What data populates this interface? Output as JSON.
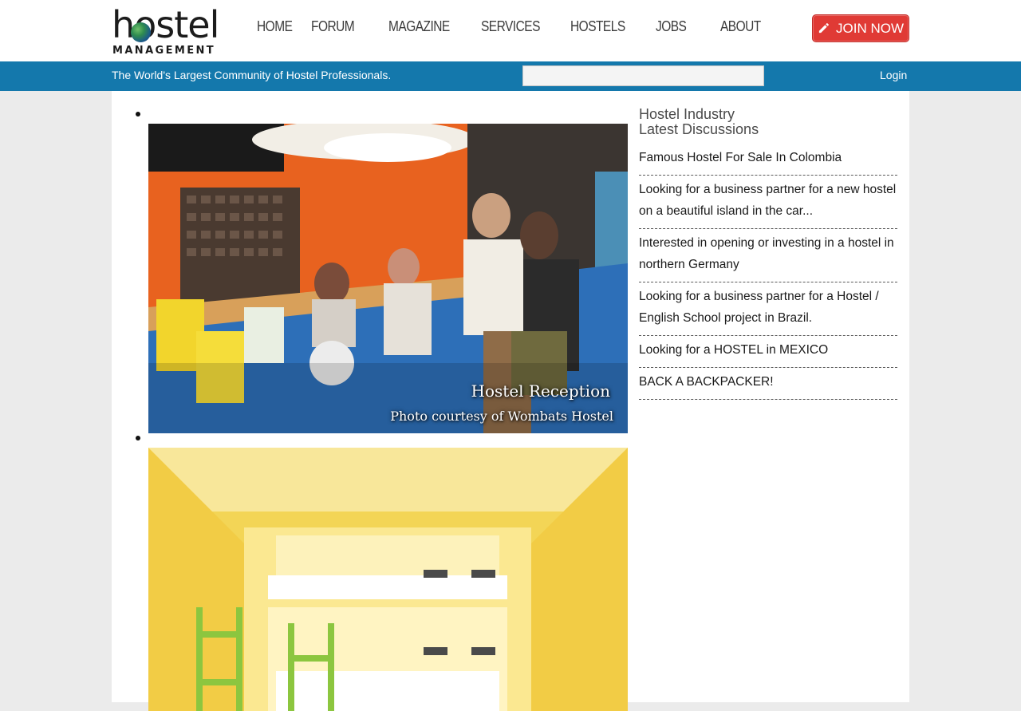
{
  "logo": {
    "word": "hostel",
    "sub": "MANAGEMENT"
  },
  "nav": {
    "items": [
      "HOME",
      "FORUM",
      "MAGAZINE",
      "SERVICES",
      "HOSTELS",
      "JOBS",
      "ABOUT"
    ],
    "join_label": "JOIN NOW"
  },
  "bar": {
    "tagline": "The World's Largest Community of Hostel Professionals.",
    "search_placeholder": "",
    "login_label": "Login"
  },
  "slides": [
    {
      "caption_title": "Hostel Reception",
      "caption_credit": "Photo courtesy of Wombats Hostel"
    },
    {
      "caption_title": "",
      "caption_credit": ""
    }
  ],
  "sidebar": {
    "heading_line1": "Hostel Industry",
    "heading_line2": "Latest Discussions",
    "discussions": [
      "Famous Hostel For Sale In Colombia",
      "Looking for a business partner for a new hostel on a beautiful island in the car...",
      "Interested in opening or investing in a hostel in northern Germany",
      "Looking for a business partner for a Hostel / English School project in Brazil.",
      "Looking for a HOSTEL in MEXICO",
      "BACK A BACKPACKER!"
    ]
  },
  "colors": {
    "brand_blue": "#1478ac",
    "join_red": "#e03a35",
    "page_bg": "#ebebeb"
  },
  "icons": {
    "join": "pencil-icon",
    "logo_globe": "globe-icon"
  }
}
